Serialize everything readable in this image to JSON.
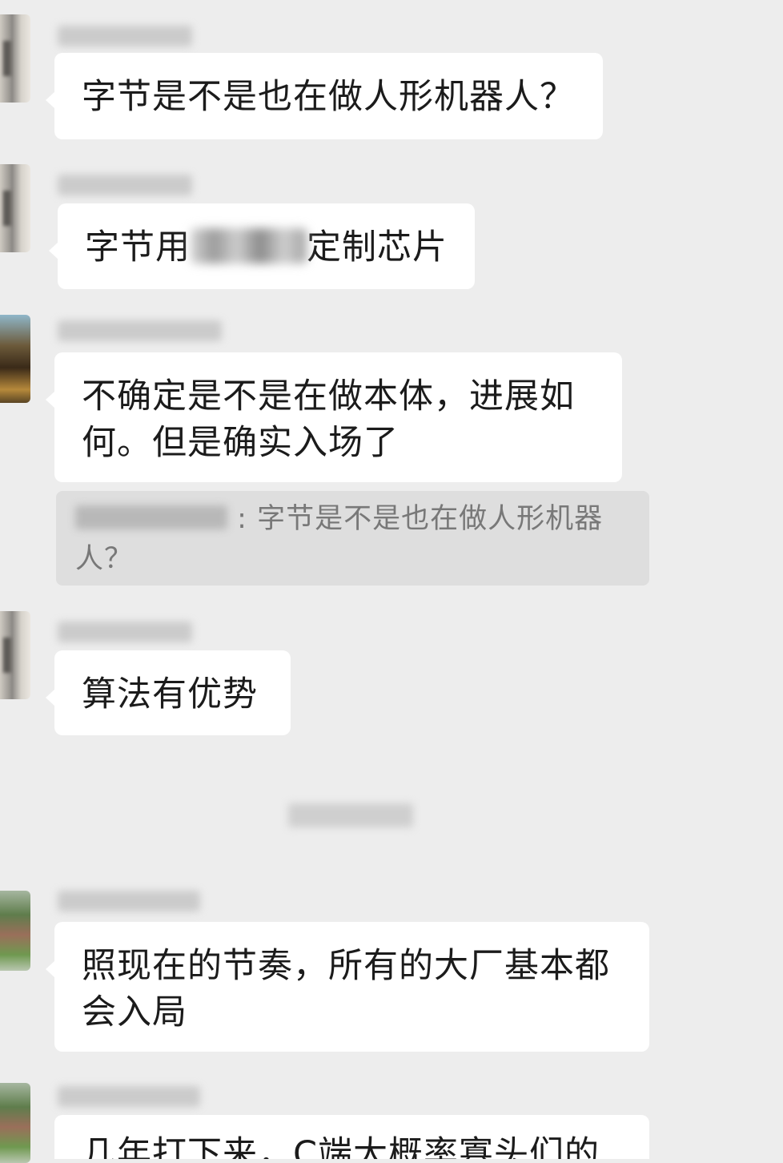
{
  "chat": {
    "messages": [
      {
        "text": "字节是不是也在做人形机器人？"
      },
      {
        "text_before": "字节用",
        "text_after": "定制芯片"
      },
      {
        "text": "不确定是不是在做本体，进展如何。但是确实入场了"
      },
      {
        "text": "算法有优势"
      },
      {
        "text": "照现在的节奏，所有的大厂基本都会入局"
      },
      {
        "text": "几年打下来，C端大概率寡头们的"
      }
    ],
    "quote": {
      "separator": ":",
      "text": "字节是不是也在做人形机器人？"
    }
  }
}
